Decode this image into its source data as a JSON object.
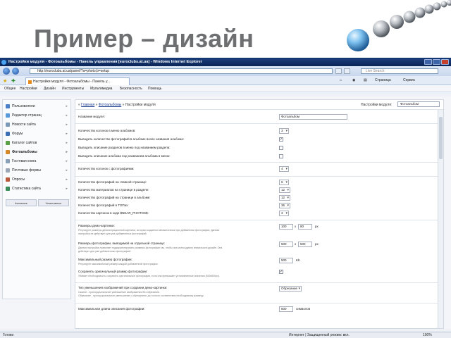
{
  "slide": {
    "title": "Пример – дизайн"
  },
  "window": {
    "title": "Настройки модуля - Фотоальбомы - Панель управления [euroclubs.at.ua] - Windows Internet Explorer"
  },
  "address": {
    "url": "http://euroclubs.at.ua/panel/?a=photo;b=setup",
    "search_placeholder": "Live Search"
  },
  "tab": {
    "label": "Настройки модуля - Фотоальбомы - Панель у..."
  },
  "command_bar": {
    "page": "Страница",
    "tools": "Сервис"
  },
  "menu": [
    "Общее",
    "Настройки",
    "Дизайн",
    "Инструменты",
    "Мультимедиа",
    "Безопасность",
    "Помощь"
  ],
  "sidebar": {
    "items": [
      {
        "label": "Пользователи",
        "color": "#4a7fc9"
      },
      {
        "label": "Редактор страниц",
        "color": "#5a9ad8"
      },
      {
        "label": "Новости сайта",
        "color": "#7a9ab8"
      },
      {
        "label": "Форум",
        "color": "#3d6fb5"
      },
      {
        "label": "Каталог сайтов",
        "color": "#5aa04a"
      },
      {
        "label": "Фотоальбомы",
        "color": "#d48a2a"
      },
      {
        "label": "Гостевая книга",
        "color": "#8aa0b8"
      },
      {
        "label": "Почтовые формы",
        "color": "#9aa6b5"
      },
      {
        "label": "Опросы",
        "color": "#b85a3a"
      },
      {
        "label": "Статистика сайта",
        "color": "#3a8a5a"
      }
    ],
    "tabs": [
      "Активные",
      "Неактивные"
    ]
  },
  "content": {
    "breadcrumb": {
      "home": "Главная",
      "section": "Фотоальбомы",
      "current": "Настройки модуля"
    },
    "module_settings_label": "Настройки модуля:",
    "module_selected": "Фотоальбом",
    "fields": {
      "module_name": {
        "label": "Название модуля:",
        "value": "Фотоальбом"
      },
      "cols_album": {
        "label": "Количество колонок в меню альбомов:",
        "value": "3"
      },
      "show_count": {
        "label": "Выводить количество фотографий в альбоме возле названия альбома:",
        "checked": "✓"
      },
      "show_desc_sections": {
        "label": "Выводить описание разделов в меню под названием раздела:"
      },
      "show_desc_album": {
        "label": "Выводить описание альбома под названием альбома в меню:"
      },
      "cols_photos": {
        "label": "Количество колонок с фотографиями:",
        "value": "4"
      },
      "photos_main": {
        "label": "Количество фотографий на главной странице:",
        "value": "6"
      },
      "materials_section": {
        "label": "Количество материалов на странице в разделе:",
        "value": "12"
      },
      "photos_album": {
        "label": "Количество фотографий на странице в альбоме:",
        "value": "12"
      },
      "photos_top": {
        "label": "Количество фотографий в ТОПах:",
        "value": "36"
      },
      "images_code": {
        "label": "Количество картинок в коде $NEAR_PHOTOS$:",
        "value": "3"
      },
      "demo_size": {
        "label": "Размеры демо-картинки:",
        "hint1": "Регулирует размеры демонстрационной картинки, которая создается автоматически при добавлении фотографии. Данная",
        "hint2": "настройка не действует для уже добавленных фотографий.",
        "w": "100",
        "h": "80",
        "unit": "px"
      },
      "photo_size": {
        "label": "Размеры фотографии, выводимой на отдельной странице:",
        "hint1": "Данная настройка позволяет подкорректировать размеры фотографии так, чтобы она могла удачно вписаться в дизайн. Она",
        "hint2": "действует для уже добавленных фотографий.",
        "w": "500",
        "h": "500",
        "unit": "px"
      },
      "max_size": {
        "label": "Максимальный размер фотографии:",
        "hint1": "Регулирует максимальный размер каждой добавленной фотографии.",
        "value": "500",
        "unit": "Kb"
      },
      "keep_original": {
        "label": "Сохранять оригинальный размер фотографии:",
        "hint1": "Убивает необходимость сохранять оригинальные фотографии, если она превышает установленные значения (500x500px).",
        "checked": "✓"
      },
      "reduce_type": {
        "label": "Тип уменьшения изображений при создании демо-картинки:",
        "hint1": "Сжатие - пропорциональное уменьшение изображения без обрезания.",
        "hint2": "Обрезание - пропорциональное уменьшение с обрезанием, до точного соответствия необходимому размеру.",
        "value": "Обрезание"
      },
      "max_desc": {
        "label": "Максимальная длина описания фотографии:",
        "value": "500",
        "unit": "символов"
      }
    }
  },
  "statusbar": {
    "left": "Готово",
    "right": "Интернет | Защищенный режим: вкл.",
    "zoom": "100%"
  }
}
